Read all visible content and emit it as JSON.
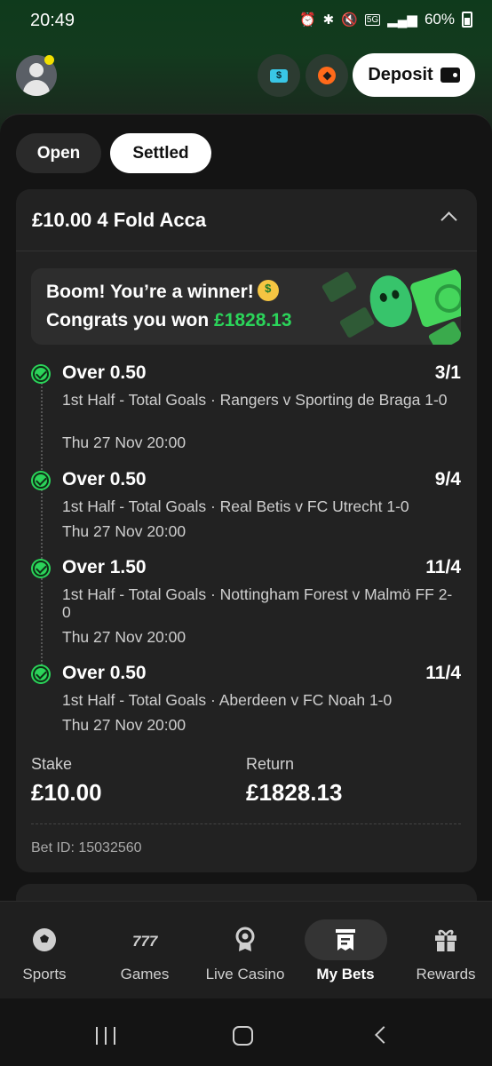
{
  "status_bar": {
    "time": "20:49",
    "battery": "60%",
    "network": "5G"
  },
  "header": {
    "deposit_label": "Deposit"
  },
  "tabs": [
    {
      "label": "Open",
      "active": false
    },
    {
      "label": "Settled",
      "active": true
    }
  ],
  "bet": {
    "title": "£10.00 4 Fold Acca",
    "winner_line1": "Boom! You’re a winner!",
    "winner_line2_prefix": "Congrats you won",
    "winner_amount": "£1828.13",
    "legs": [
      {
        "selection": "Over 0.50",
        "odds": "3/1",
        "description": "1st Half - Total Goals · Rangers v Sporting de Braga 1-0",
        "time": "Thu 27 Nov 20:00"
      },
      {
        "selection": "Over 0.50",
        "odds": "9/4",
        "description": "1st Half - Total Goals · Real Betis v FC Utrecht 1-0",
        "time": "Thu 27 Nov 20:00"
      },
      {
        "selection": "Over 1.50",
        "odds": "11/4",
        "description": "1st Half - Total Goals · Nottingham Forest v Malmö FF 2-0",
        "time": "Thu 27 Nov 20:00"
      },
      {
        "selection": "Over 0.50",
        "odds": "11/4",
        "description": "1st Half - Total Goals · Aberdeen v FC Noah 1-0",
        "time": "Thu 27 Nov 20:00"
      }
    ],
    "stake_label": "Stake",
    "stake_value": "£10.00",
    "return_label": "Return",
    "return_value": "£1828.13",
    "bet_id": "Bet ID: 15032560"
  },
  "bottom_nav": [
    {
      "label": "Sports",
      "icon": "football-icon"
    },
    {
      "label": "Games",
      "icon": "slots-777-icon"
    },
    {
      "label": "Live Casino",
      "icon": "casino-award-icon"
    },
    {
      "label": "My Bets",
      "icon": "bet-slip-icon",
      "active": true
    },
    {
      "label": "Rewards",
      "icon": "gift-icon"
    }
  ],
  "colors": {
    "win_green": "#2bd45a",
    "card_bg": "#222222",
    "accent_orange": "#ff6a1a",
    "accent_cyan": "#39c6e6"
  }
}
